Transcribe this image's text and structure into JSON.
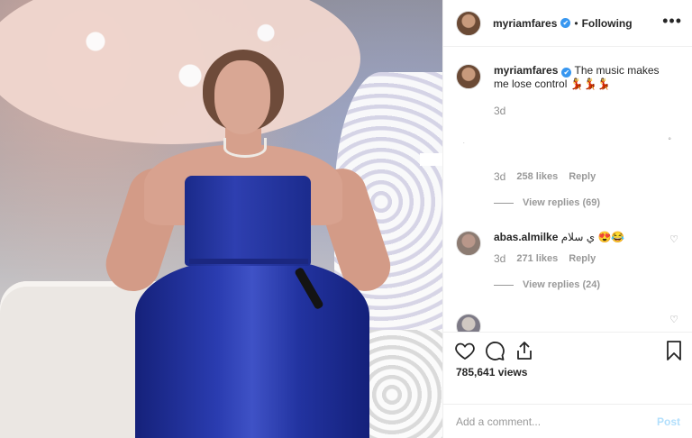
{
  "post": {
    "author": "myriamfares",
    "verified_mark": "✔",
    "follow_status": "Following",
    "more_icon": "more-horizontal-icon"
  },
  "caption": {
    "author": "myriamfares",
    "text": "The music makes me lose control",
    "emojis": "💃💃💃",
    "time": "3d"
  },
  "comments": [
    {
      "time": "3d",
      "likes": "258 likes",
      "reply": "Reply",
      "view_replies": "View replies (69)"
    },
    {
      "author": "abas.almilke",
      "text": "ي سلام",
      "emojis": "😍😂",
      "time": "3d",
      "likes": "271 likes",
      "reply": "Reply",
      "view_replies": "View replies (24)"
    }
  ],
  "stats": {
    "views": "785,641 views"
  },
  "comment_box": {
    "placeholder": "Add a comment...",
    "post_label": "Post"
  },
  "icons": [
    "heart-icon",
    "comment-icon",
    "share-icon",
    "bookmark-icon"
  ]
}
